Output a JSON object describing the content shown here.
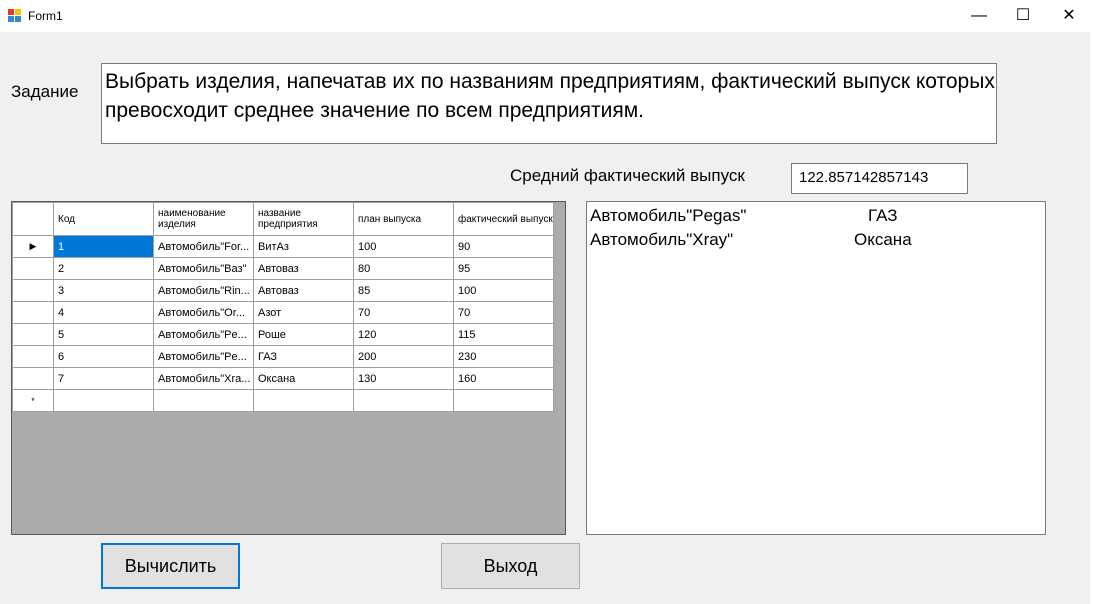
{
  "window": {
    "title": "Form1",
    "minimize_glyph": "—",
    "maximize_glyph": "☐",
    "close_glyph": "✕"
  },
  "task": {
    "label": "Задание",
    "text": "Выбрать изделия, напечатав их по названиям предприятиям, фактический выпуск которых превосходит среднее значение по всем предприятиям."
  },
  "average": {
    "label": "Средний фактический выпуск",
    "value": "122.857142857143"
  },
  "grid": {
    "columns": [
      "Код",
      "наименование изделия",
      "название предприятия",
      "план выпуска",
      "фактический выпуск"
    ],
    "rows": [
      [
        "1",
        "Автомобиль\"For...",
        "ВитАз",
        "100",
        "90"
      ],
      [
        "2",
        "Автомобиль\"Ваз\"",
        "Автоваз",
        "80",
        "95"
      ],
      [
        "3",
        "Автомобиль\"Rin...",
        "Автоваз",
        "85",
        "100"
      ],
      [
        "4",
        "Автомобиль\"Or...",
        "Азот",
        "70",
        "70"
      ],
      [
        "5",
        "Автомобиль\"Pe...",
        "Роше",
        "120",
        "115"
      ],
      [
        "6",
        "Автомобиль\"Pe...",
        "ГАЗ",
        "200",
        "230"
      ],
      [
        "7",
        "Автомобиль\"Xra...",
        "Оксана",
        "130",
        "160"
      ]
    ],
    "current_row_glyph": "▶",
    "new_row_glyph": "*"
  },
  "results": [
    {
      "product": "Автомобиль\"Pegas\"",
      "enterprise": "ГАЗ"
    },
    {
      "product": "Автомобиль\"Xray\"",
      "enterprise": "Оксана"
    }
  ],
  "buttons": {
    "calculate": "Вычислить",
    "exit": "Выход"
  }
}
